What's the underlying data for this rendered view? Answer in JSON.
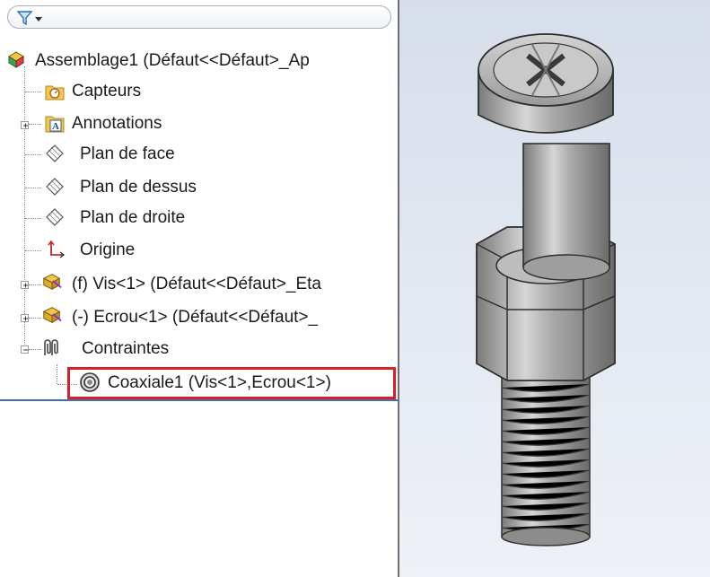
{
  "toolbar": {
    "filter_icon": "filter-icon",
    "dropdown_icon": "chevron-down-icon"
  },
  "tree": {
    "root": {
      "label": "Assemblage1  (Défaut<<Défaut>_Ap",
      "icon": "assembly-icon"
    },
    "items": [
      {
        "label": "Capteurs",
        "icon": "sensor-folder-icon"
      },
      {
        "label": "Annotations",
        "icon": "annotations-folder-icon"
      },
      {
        "label": "Plan de face",
        "icon": "plane-icon"
      },
      {
        "label": "Plan de dessus",
        "icon": "plane-icon"
      },
      {
        "label": "Plan de droite",
        "icon": "plane-icon"
      },
      {
        "label": "Origine",
        "icon": "origin-icon"
      },
      {
        "label": "(f) Vis<1> (Défaut<<Défaut>_Eta",
        "icon": "part-icon"
      },
      {
        "label": "(-) Ecrou<1> (Défaut<<Défaut>_",
        "icon": "part-icon"
      },
      {
        "label": "Contraintes",
        "icon": "mates-icon"
      }
    ],
    "child": {
      "label": "Coaxiale1 (Vis<1>,Ecrou<1>)",
      "icon": "concentric-mate-icon"
    }
  },
  "colors": {
    "highlight_border": "#d8202a",
    "folder_yellow": "#f2c94c",
    "viewport_bg": "#dfe5ef"
  },
  "viewport": {
    "model": "screw-and-nut-3d-model"
  }
}
